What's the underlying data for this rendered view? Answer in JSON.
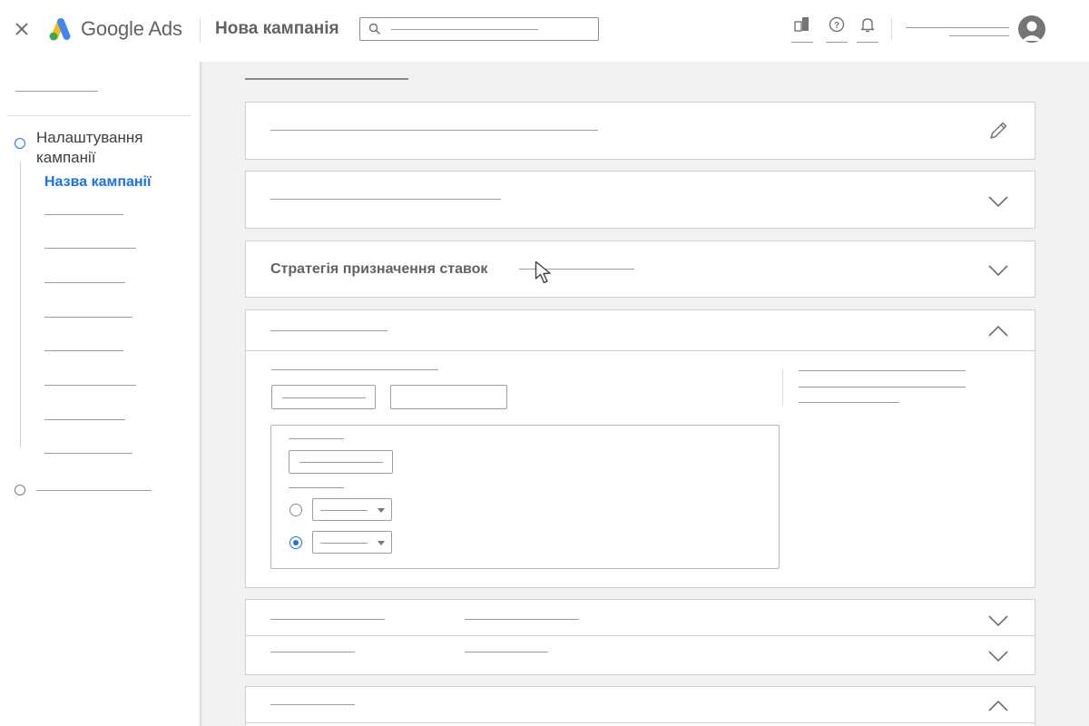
{
  "header": {
    "brand": "Google Ads",
    "page_title": "Нова кампанія"
  },
  "icons": {
    "close": "close-icon",
    "logo": "google-ads-logo",
    "search": "search-icon",
    "reports": "reports-icon",
    "help": "help-icon",
    "notifications": "bell-icon",
    "account": "account-avatar"
  },
  "sidebar": {
    "step1_title": "Налаштування кампанії",
    "step1_current": "Назва кампанії"
  },
  "main": {
    "bidding_title": "Стратегія призначення ставок"
  },
  "colors": {
    "accent": "#1a73e8",
    "text": "#3c4043",
    "muted": "#5f6368",
    "background": "#f1f1f1",
    "placeholder": "#9e9e9e"
  }
}
